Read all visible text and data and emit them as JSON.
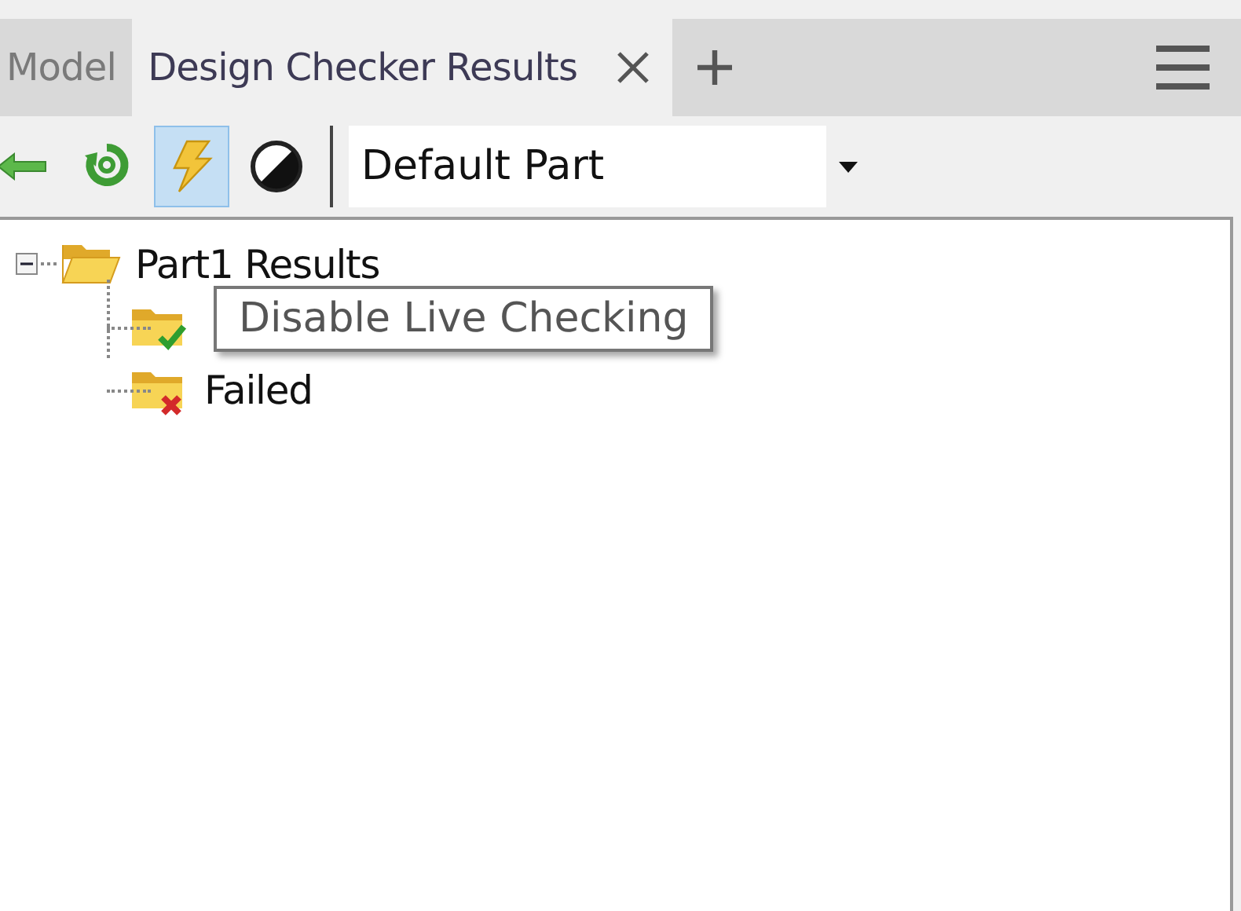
{
  "tabs": [
    {
      "label": "Model",
      "selected": false
    },
    {
      "label": "Design Checker Results",
      "selected": true,
      "closable": true
    }
  ],
  "toolbar": {
    "buttons": [
      {
        "kind": "back",
        "pressed": false
      },
      {
        "kind": "refresh",
        "pressed": false
      },
      {
        "kind": "lightning",
        "pressed": true
      },
      {
        "kind": "contrast",
        "pressed": false
      }
    ],
    "dropdown": {
      "value": "Default Part"
    }
  },
  "tree": [
    {
      "label": "Part1 Results",
      "kind": "folder",
      "expanded": true,
      "children": [
        {
          "kind": "passed"
        },
        {
          "label": "Failed",
          "kind": "failed"
        }
      ]
    }
  ],
  "tooltip": {
    "text": "Disable Live Checking"
  }
}
